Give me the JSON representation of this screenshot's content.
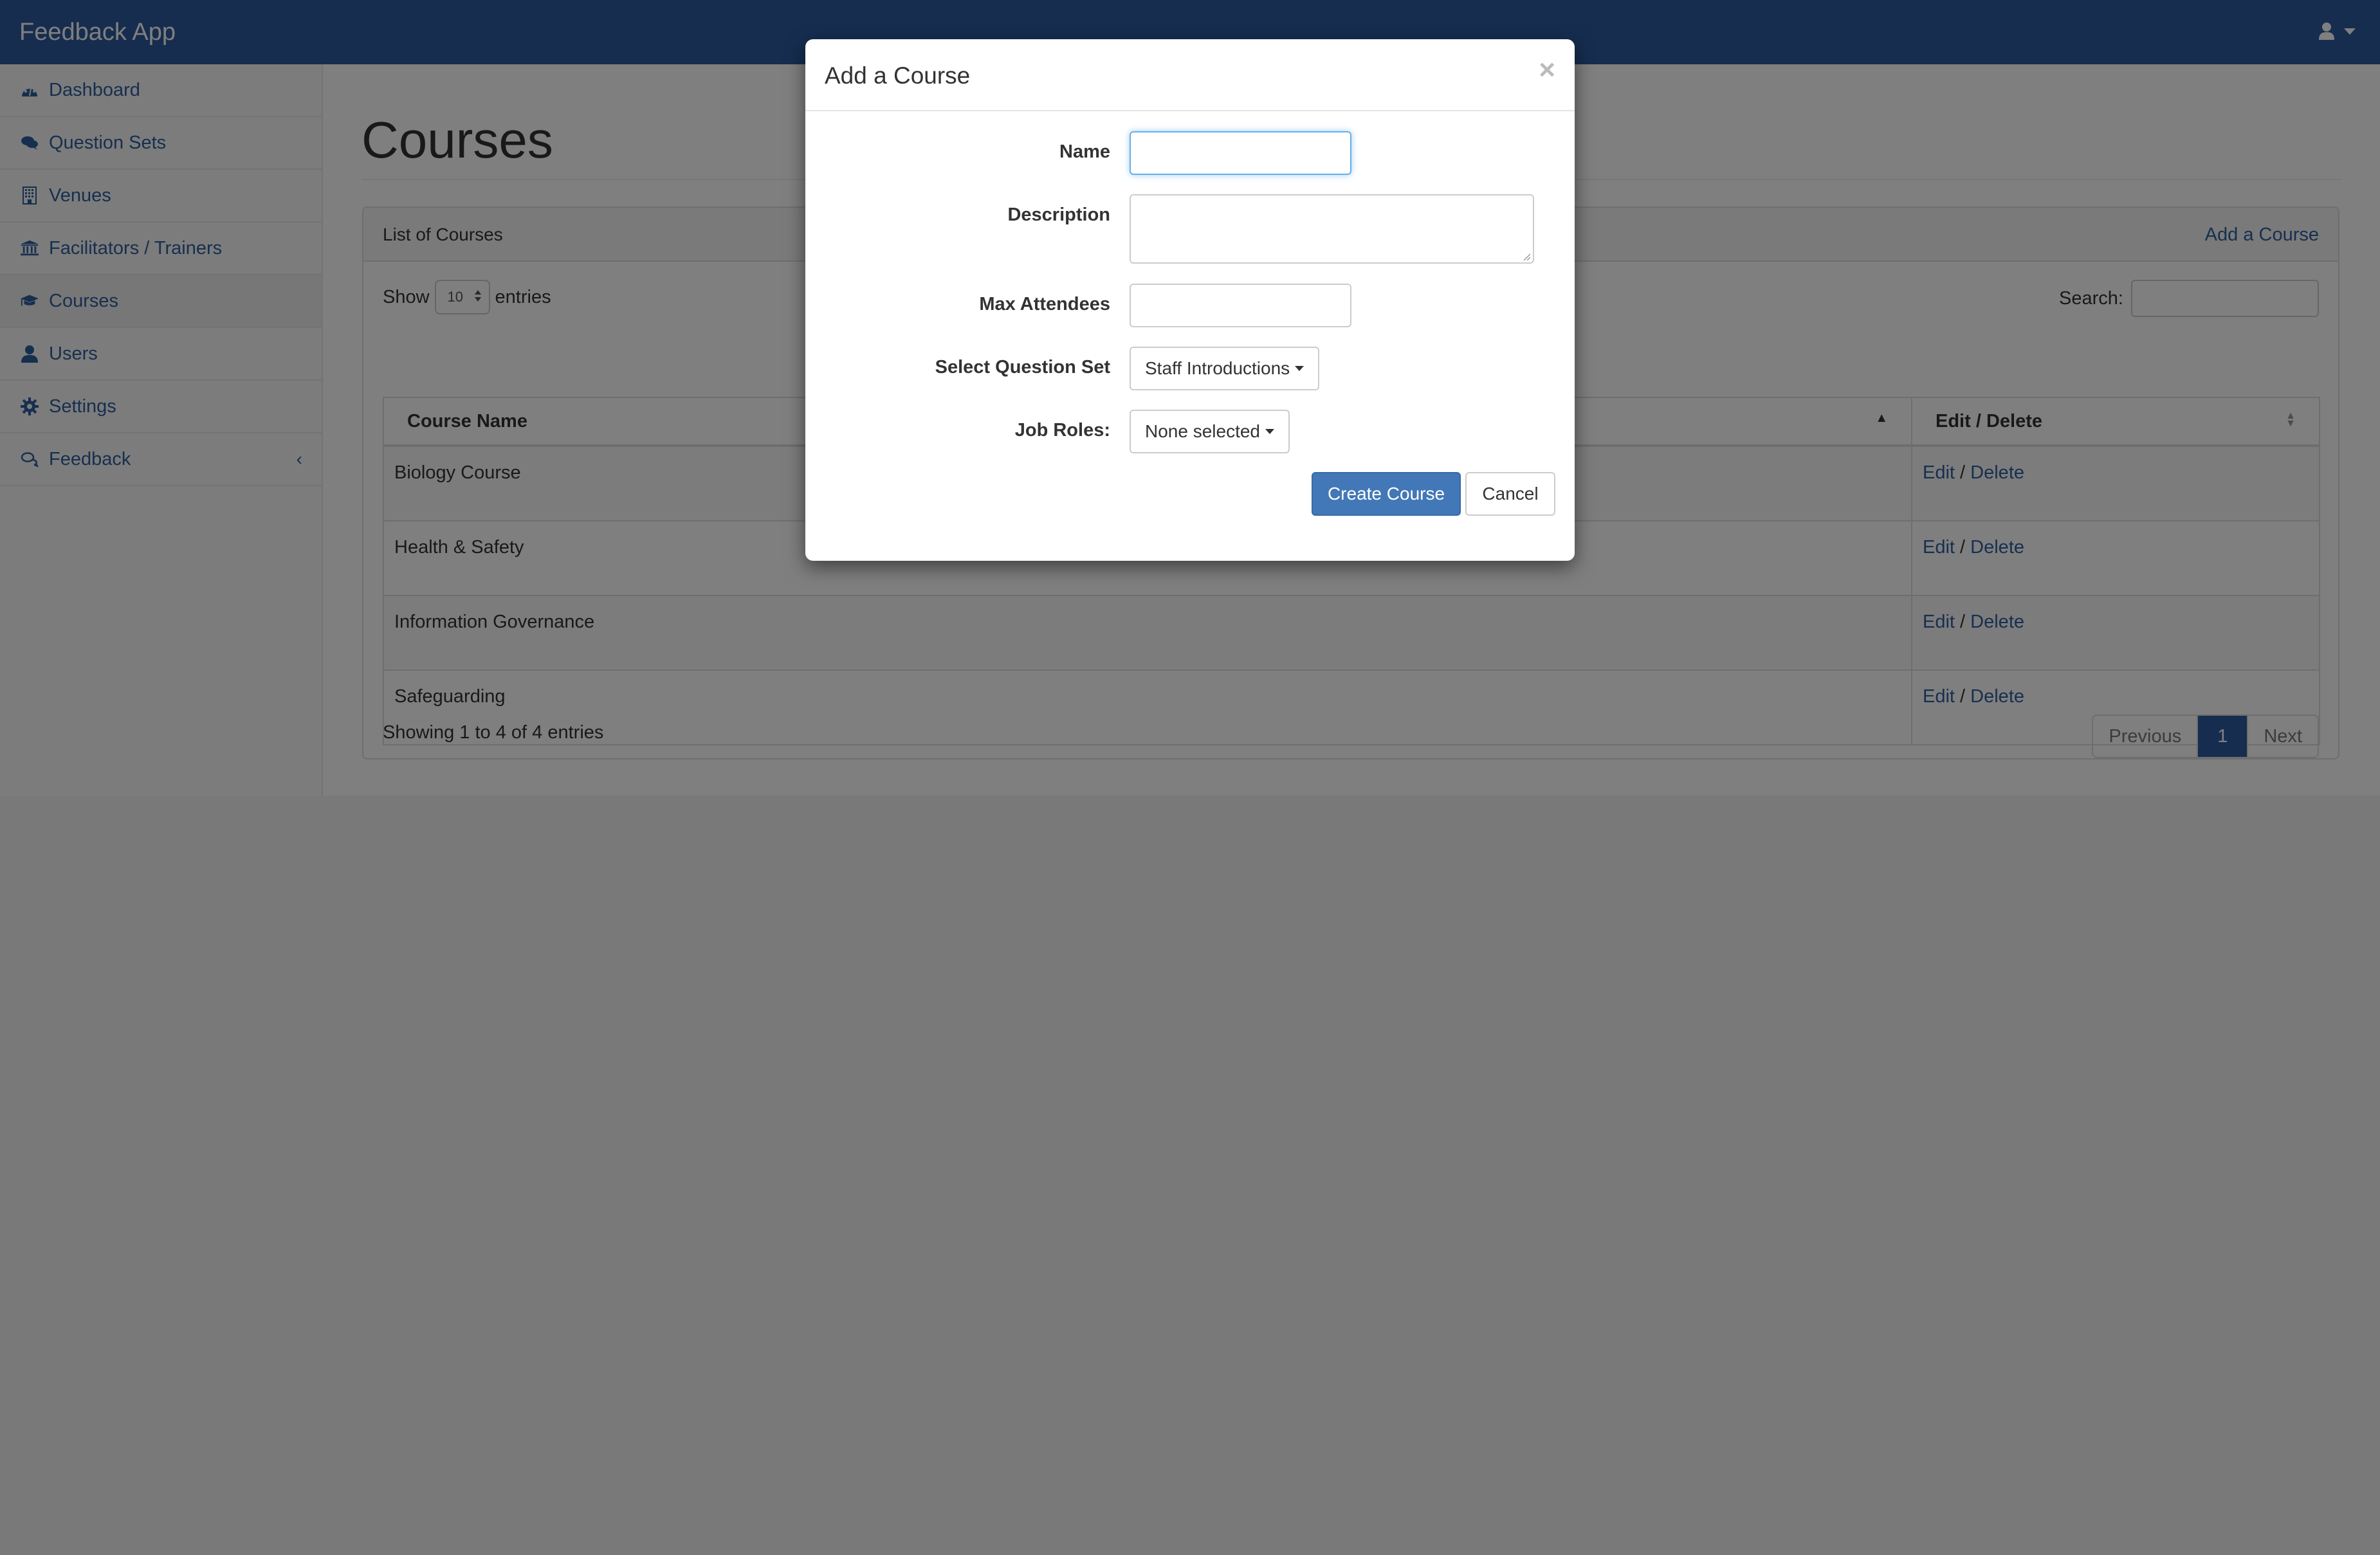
{
  "app": {
    "brand": "Feedback App",
    "user_menu_icon": "user-icon",
    "user_menu_caret": "caret-down-icon"
  },
  "sidebar": {
    "items": [
      {
        "label": "Dashboard",
        "icon": "dashboard-icon",
        "active": false
      },
      {
        "label": "Question Sets",
        "icon": "comments-icon",
        "active": false
      },
      {
        "label": "Venues",
        "icon": "building-icon",
        "active": false
      },
      {
        "label": "Facilitators / Trainers",
        "icon": "institution-icon",
        "active": false
      },
      {
        "label": "Courses",
        "icon": "graduation-cap-icon",
        "active": true
      },
      {
        "label": "Users",
        "icon": "user-icon",
        "active": false
      },
      {
        "label": "Settings",
        "icon": "gear-icon",
        "active": false
      },
      {
        "label": "Feedback",
        "icon": "comments-outline-icon",
        "active": false,
        "has_submenu": true
      }
    ],
    "submenu_caret": "‹"
  },
  "page": {
    "title": "Courses",
    "panel": {
      "heading": "List of Courses",
      "add_link": "Add a Course"
    },
    "length_menu": {
      "prefix": "Show",
      "value": "10",
      "suffix": "entries"
    },
    "search": {
      "label": "Search:",
      "value": ""
    },
    "table": {
      "columns": [
        "Course Name",
        "Edit / Delete"
      ],
      "rows": [
        {
          "name": "Biology Course",
          "edit": "Edit",
          "sep": "/",
          "delete": "Delete"
        },
        {
          "name": "Health & Safety",
          "edit": "Edit",
          "sep": "/",
          "delete": "Delete"
        },
        {
          "name": "Information Governance",
          "edit": "Edit",
          "sep": "/",
          "delete": "Delete"
        },
        {
          "name": "Safeguarding",
          "edit": "Edit",
          "sep": "/",
          "delete": "Delete"
        }
      ]
    },
    "info": "Showing 1 to 4 of 4 entries",
    "pagination": {
      "previous": "Previous",
      "current": "1",
      "next": "Next"
    }
  },
  "modal": {
    "title": "Add a Course",
    "close": "×",
    "fields": {
      "name": {
        "label": "Name",
        "value": ""
      },
      "description": {
        "label": "Description",
        "value": ""
      },
      "max_attendees": {
        "label": "Max Attendees",
        "value": ""
      },
      "question_set": {
        "label": "Select Question Set",
        "selected": "Staff Introductions"
      },
      "job_roles": {
        "label": "Job Roles:",
        "selected": "None selected"
      }
    },
    "buttons": {
      "create": "Create Course",
      "cancel": "Cancel"
    }
  },
  "colors": {
    "navbar": "#2c5a9e",
    "link": "#2f5f9e",
    "primary_button": "#4278b7",
    "focus_border": "#66afe9",
    "overlay": "rgba(0,0,0,0.5)"
  }
}
